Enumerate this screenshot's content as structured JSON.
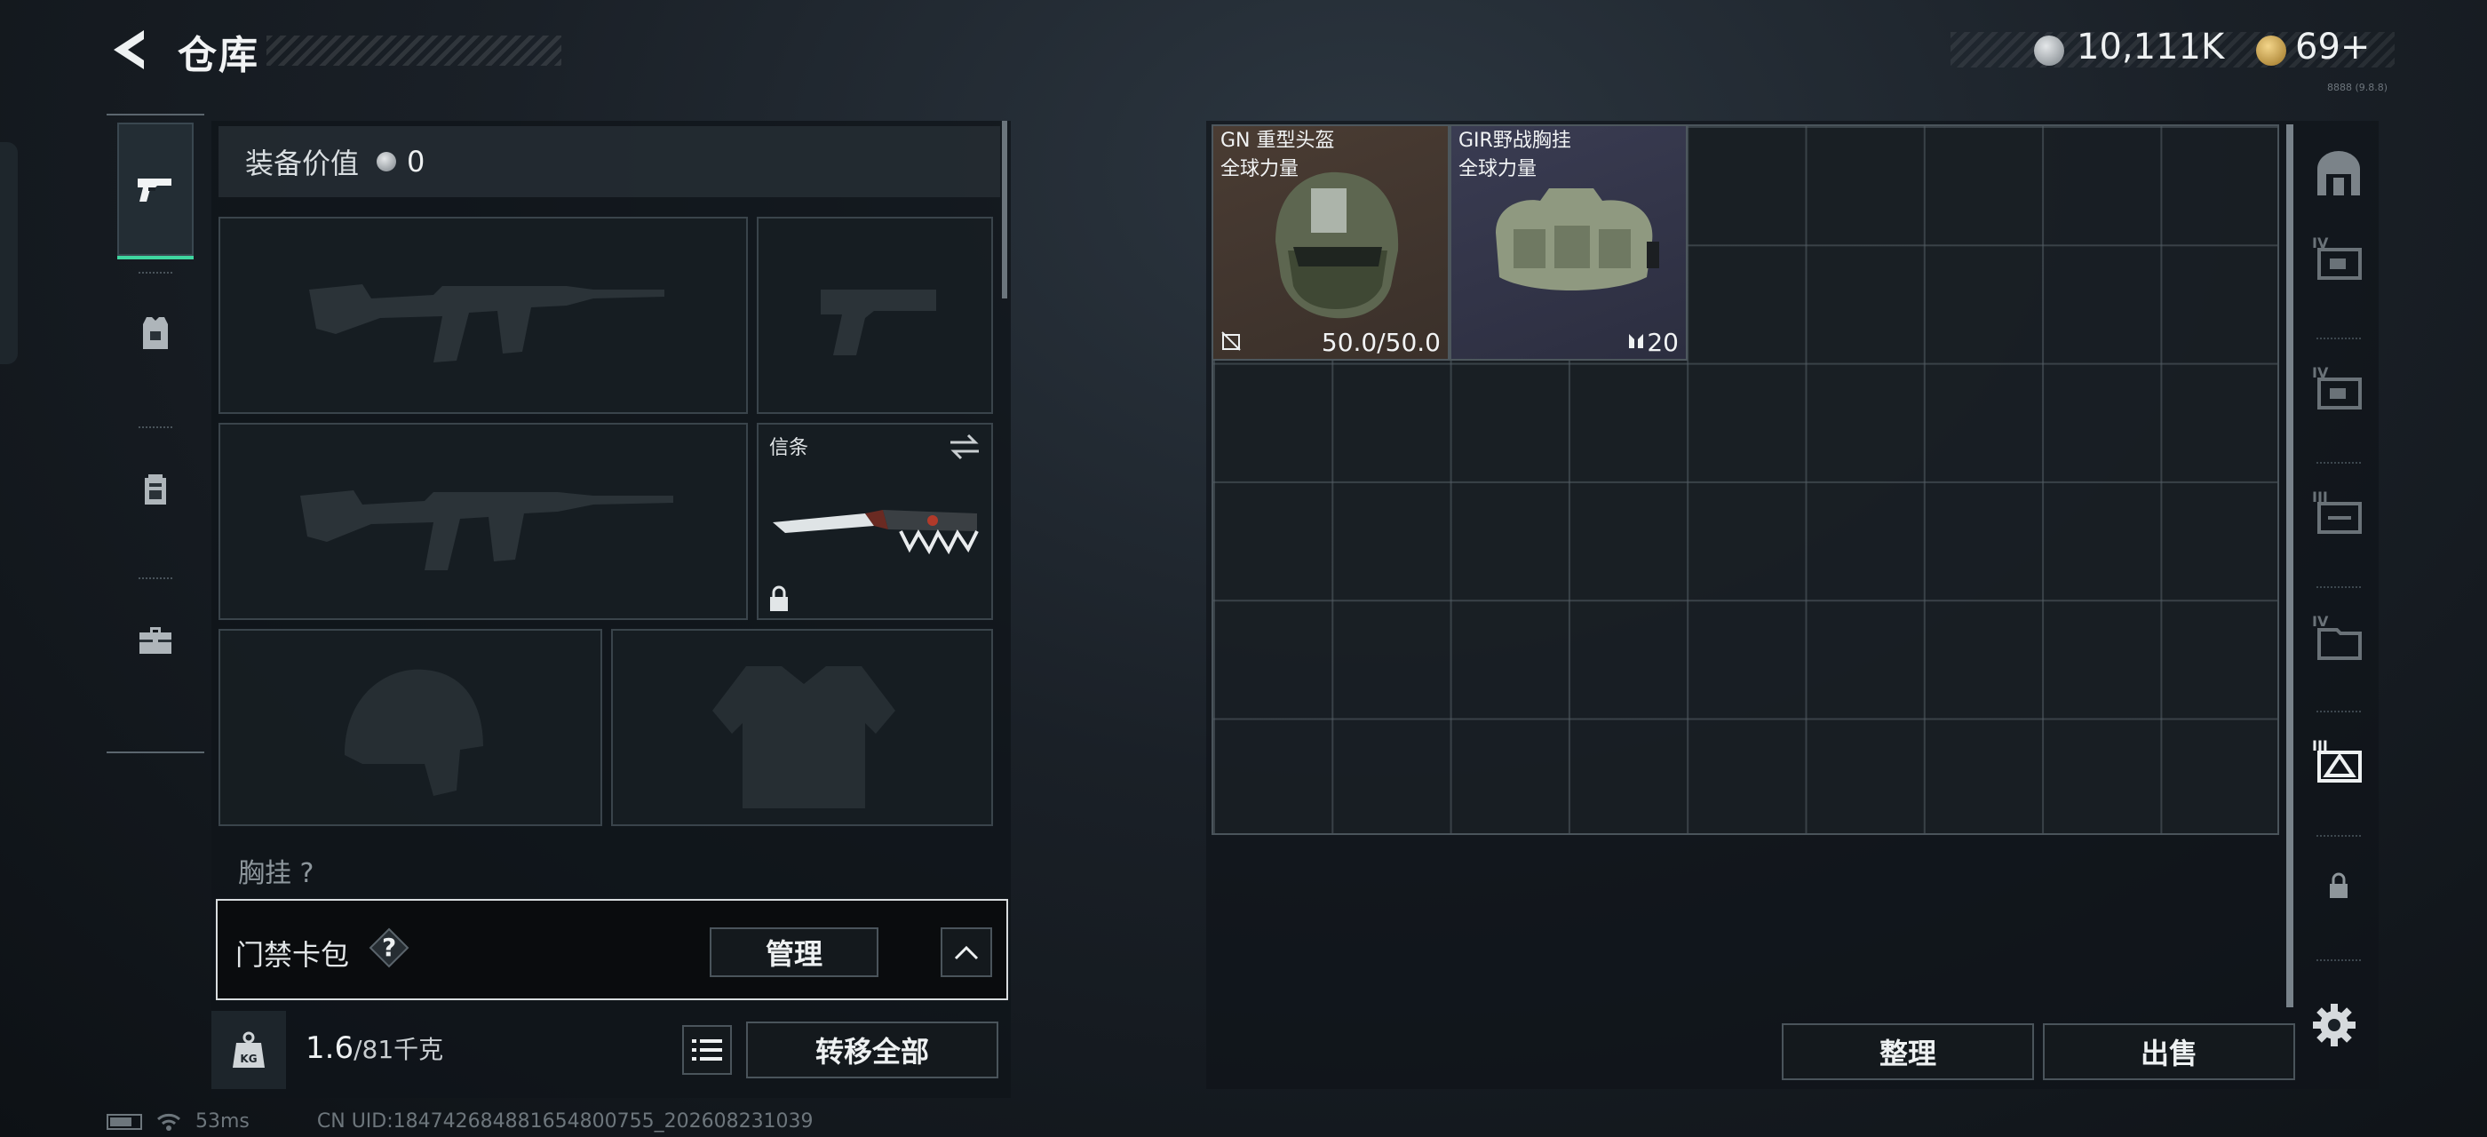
{
  "header": {
    "title": "仓库",
    "silver_currency": "10,111K",
    "gold_currency": "69+",
    "build_tag": "8888 (9.8.8)"
  },
  "nav": {
    "items": [
      {
        "icon": "pistol-icon",
        "active": true
      },
      {
        "icon": "armor-vest-icon",
        "active": false
      },
      {
        "icon": "backpack-icon",
        "active": false
      },
      {
        "icon": "briefcase-icon",
        "active": false
      }
    ]
  },
  "loadout": {
    "equip_value_label": "装备价值",
    "equip_value": "0",
    "melee_label": "信条",
    "chest_rig_label": "胸挂 ?",
    "keycard_label": "门禁卡包",
    "keycard_help": "?",
    "manage_label": "管理",
    "weight_value": "1.6",
    "weight_max": "/81千克",
    "transfer_all_label": "转移全部"
  },
  "stash": {
    "items": [
      {
        "name": "GN 重型头盔",
        "subtitle": "全球力量",
        "stat": "50.0/50.0",
        "stat_icon": "durability-icon"
      },
      {
        "name": "GIR野战胸挂",
        "subtitle": "全球力量",
        "stat": "20",
        "stat_icon": "capacity-icon"
      }
    ],
    "sort_label": "整理",
    "sell_label": "出售"
  },
  "status_bar": {
    "ping": "53ms",
    "uid": "CN UID:184742684881654800755_202608231039"
  },
  "colors": {
    "accent": "#3fd6a0",
    "panel": "#0f1419",
    "border": "#4a545b"
  }
}
